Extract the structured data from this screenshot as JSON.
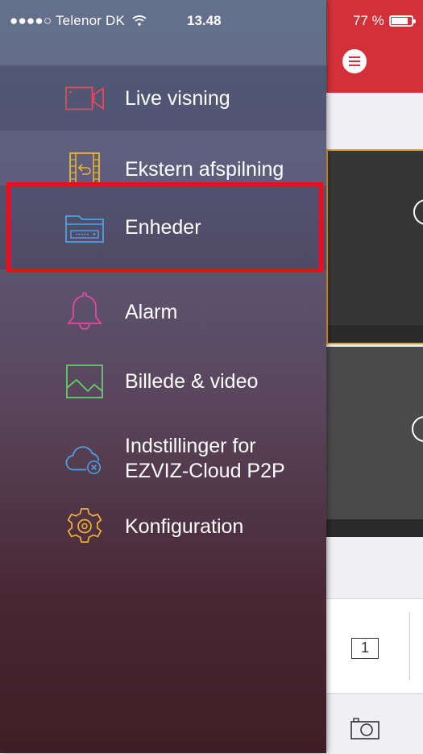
{
  "status_bar": {
    "signal": "●●●●○",
    "carrier": "Telenor DK",
    "time": "13.48",
    "battery_percent": "77 %",
    "battery_level": 0.77
  },
  "drawer": {
    "items": [
      {
        "label": "Live visning",
        "icon": "video-camera-icon",
        "color": "#e64a5a"
      },
      {
        "label": "Ekstern afspilning",
        "icon": "playback-film-icon",
        "color": "#f0b23a"
      },
      {
        "label": "Enheder",
        "icon": "device-folder-icon",
        "color": "#4aa3e8"
      },
      {
        "label": "Alarm",
        "icon": "bell-icon",
        "color": "#e24aa0"
      },
      {
        "label": "Billede & video",
        "icon": "picture-icon",
        "color": "#5fcf6a"
      },
      {
        "label": "Indstillinger for\nEZVIZ-Cloud P2P",
        "icon": "cloud-settings-icon",
        "color": "#4aa3e8"
      },
      {
        "label": "Konfiguration",
        "icon": "gear-icon",
        "color": "#f0b23a"
      }
    ]
  },
  "app": {
    "header_color": "#d3313a",
    "split_label": "1",
    "highlight_color": "#e3121a"
  }
}
